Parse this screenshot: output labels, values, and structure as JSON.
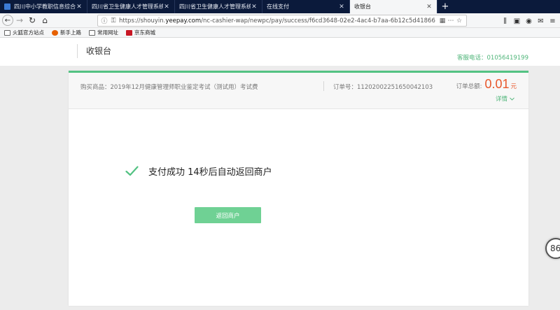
{
  "tabs": [
    {
      "title": "四川中小学教职信息综合管理平台",
      "active": false
    },
    {
      "title": "四川省卫生健康人才管理系统",
      "active": false
    },
    {
      "title": "四川省卫生健康人才管理系统",
      "active": false
    },
    {
      "title": "在线支付",
      "active": false
    },
    {
      "title": "收银台",
      "active": true
    }
  ],
  "browser": {
    "new_tab": "+",
    "url_prefix": "https://shouyin.",
    "url_domain": "yeepay.com",
    "url_path": "/nc-cashier-wap/newpc/pay/success/f6cd3648-02e2-4ac4-b7aa-6b12c5d41866"
  },
  "bookmarks": [
    {
      "label": "火狐官方站点",
      "icon_color": "#e66000"
    },
    {
      "label": "新手上路",
      "icon_color": "#d93a2b"
    },
    {
      "label": "常用网址",
      "icon_color": "#8a8a8a"
    },
    {
      "label": "京东商城",
      "icon_color": "#c81623"
    }
  ],
  "header": {
    "title": "收银台",
    "phone": "客服电话：01056419199"
  },
  "order": {
    "goods": "购买商品：2019年12月健康管理师职业鉴定考试（测试用）考试费",
    "order_no": "订单号：1120200225165004210​3",
    "amount_label": "订单总额:",
    "amount": "0.01",
    "unit": "元",
    "detail": "详情"
  },
  "result": {
    "message": "支付成功 14秒后自动返回商户",
    "return_button": "返回商户"
  },
  "float_badge": "86",
  "colors": {
    "accent_green": "#53c283",
    "amount_orange": "#e8572b",
    "button_green": "#6fd194"
  }
}
